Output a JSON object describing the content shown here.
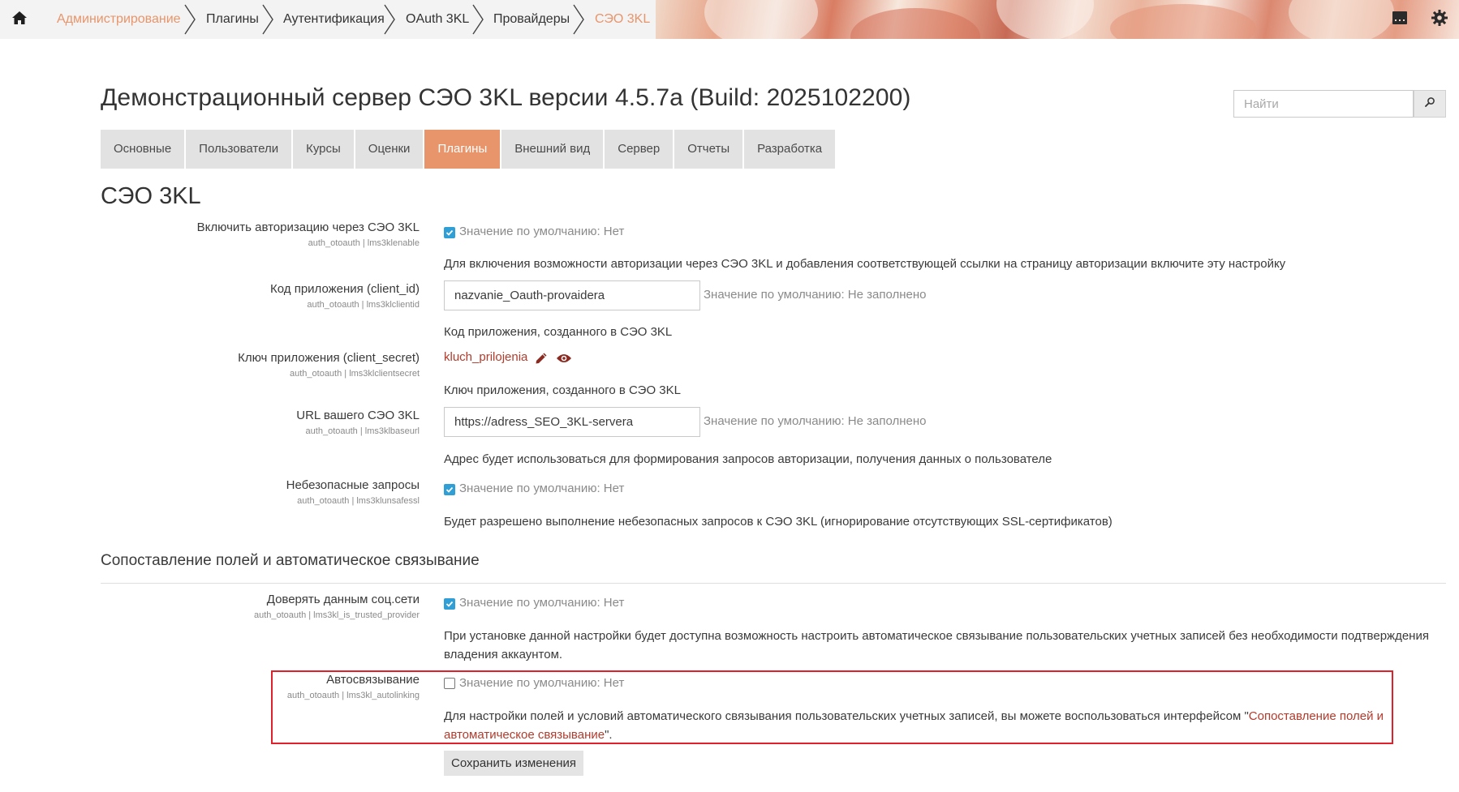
{
  "breadcrumbs": [
    {
      "label": "Администрирование",
      "accent": true
    },
    {
      "label": "Плагины",
      "accent": false
    },
    {
      "label": "Аутентификация",
      "accent": false
    },
    {
      "label": "OAuth 3KL",
      "accent": false
    },
    {
      "label": "Провайдеры",
      "accent": false
    },
    {
      "label": "СЭО 3KL",
      "accent": true
    }
  ],
  "header": {
    "title": "Демонстрационный сервер СЭО 3KL версии 4.5.7a (Build: 2025102200)",
    "search_placeholder": "Найти"
  },
  "tabs": [
    "Основные",
    "Пользователи",
    "Курсы",
    "Оценки",
    "Плагины",
    "Внешний вид",
    "Сервер",
    "Отчеты",
    "Разработка"
  ],
  "active_tab": "Плагины",
  "page": {
    "section_title": "СЭО 3KL",
    "settings": {
      "enable": {
        "label": "Включить авторизацию через СЭО 3KL",
        "key": "auth_otoauth | lms3klenable",
        "checked": true,
        "default": "Значение по умолчанию: Нет",
        "description": "Для включения возможности авторизации через СЭО 3KL и добавления соответствующей ссылки на страницу авторизации включите эту настройку"
      },
      "client_id": {
        "label": "Код приложения (client_id)",
        "key": "auth_otoauth | lms3klclientid",
        "value": "nazvanie_Oauth-provaidera",
        "default": "Значение по умолчанию: Не заполнено",
        "description": "Код приложения, созданного в СЭО 3KL"
      },
      "client_secret": {
        "label": "Ключ приложения (client_secret)",
        "key": "auth_otoauth | lms3klclientsecret",
        "value": "kluch_prilojenia",
        "description": "Ключ приложения, созданного в СЭО 3KL"
      },
      "baseurl": {
        "label": "URL вашего СЭО 3KL",
        "key": "auth_otoauth | lms3klbaseurl",
        "value": "https://adress_SEO_3KL-servera",
        "default": "Значение по умолчанию: Не заполнено",
        "description": "Адрес будет использоваться для формирования запросов авторизации, получения данных о пользователе"
      },
      "unsafessl": {
        "label": "Небезопасные запросы",
        "key": "auth_otoauth | lms3klunsafessl",
        "checked": true,
        "default": "Значение по умолчанию: Нет",
        "description": "Будет разрешено выполнение небезопасных запросов к СЭО 3KL (игнорирование отсутствующих SSL-сертификатов)"
      }
    },
    "subsection_title": "Сопоставление полей и автоматическое связывание",
    "mapping": {
      "trusted": {
        "label": "Доверять данным соц.сети",
        "key": "auth_otoauth | lms3kl_is_trusted_provider",
        "checked": true,
        "default": "Значение по умолчанию: Нет",
        "description": "При установке данной настройки будет доступна возможность настроить автоматическое связывание пользовательских учетных записей без необходимости подтверждения владения аккаунтом."
      },
      "autolinking": {
        "label": "Автосвязывание",
        "key": "auth_otoauth | lms3kl_autolinking",
        "checked": false,
        "default": "Значение по умолчанию: Нет",
        "description_before": "Для настройки полей и условий автоматического связывания пользовательских учетных записей, вы можете воспользоваться интерфейсом \"",
        "description_link": "Сопоставление полей и автоматическое связывание",
        "description_after": "\"."
      }
    },
    "save_label": "Сохранить изменения"
  },
  "colors": {
    "accent": "#e8956b",
    "checkbox": "#2f9fd6",
    "link": "#b33b2c",
    "highlight_border": "#e0202a"
  },
  "icons": {
    "home": "home-icon",
    "messages": "message-drawer-icon",
    "settings": "gear-icon",
    "search": "search-icon",
    "edit": "pencil-icon",
    "reveal": "eye-icon"
  }
}
